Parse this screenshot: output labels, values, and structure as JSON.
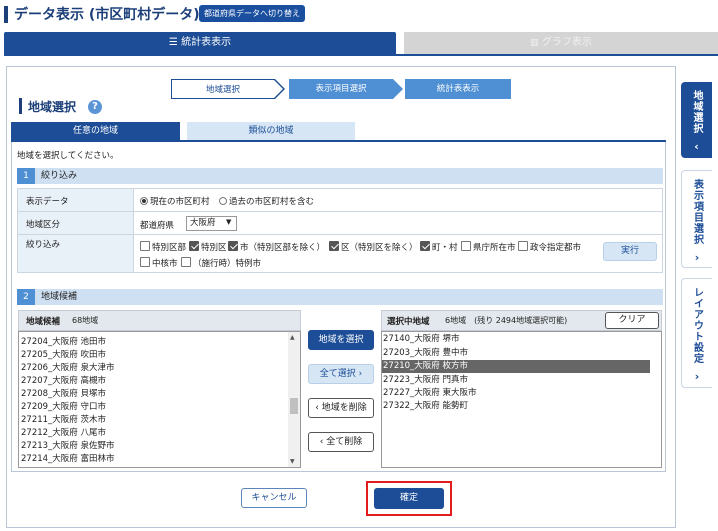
{
  "page": {
    "title": "データ表示 (市区町村データ)",
    "switch_button": "都道府県データへ切り替え"
  },
  "top_tabs": {
    "stats": "統計表表示",
    "graph": "グラフ表示"
  },
  "steps": [
    "地域選択",
    "表示項目選択",
    "統計表表示"
  ],
  "heading": "地域選択",
  "help_icon": "?",
  "sub_tabs": [
    "任意の地域",
    "類似の地域"
  ],
  "instruction": "地域を選択してください。",
  "section1": {
    "num": "1",
    "label": "絞り込み",
    "rows": {
      "display_data": {
        "label": "表示データ",
        "options": [
          "現在の市区町村",
          "過去の市区町村を含む"
        ],
        "selected": 0
      },
      "region_type": {
        "label": "地域区分",
        "prefix": "都道府県",
        "select_value": "大阪府"
      },
      "filter": {
        "label": "絞り込み",
        "checkboxes": [
          {
            "label": "特別区部",
            "checked": false
          },
          {
            "label": "特別区",
            "checked": true
          },
          {
            "label": "市（特別区部を除く）",
            "checked": true
          },
          {
            "label": "区（特別区を除く）",
            "checked": true
          },
          {
            "label": "町・村",
            "checked": true
          },
          {
            "label": "県庁所在市",
            "checked": false
          },
          {
            "label": "政令指定都市",
            "checked": false
          },
          {
            "label": "中核市",
            "checked": false
          },
          {
            "label": "（施行時）特例市",
            "checked": false
          }
        ],
        "run_button": "実行"
      }
    }
  },
  "section2": {
    "num": "2",
    "label": "地域候補"
  },
  "candidates": {
    "title": "地域候補",
    "count": "68地域",
    "items": [
      "27204_大阪府 池田市",
      "27205_大阪府 吹田市",
      "27206_大阪府 泉大津市",
      "27207_大阪府 高槻市",
      "27208_大阪府 貝塚市",
      "27209_大阪府 守口市",
      "27211_大阪府 茨木市",
      "27212_大阪府 八尾市",
      "27213_大阪府 泉佐野市",
      "27214_大阪府 富田林市"
    ]
  },
  "middle_buttons": {
    "select": "地域を選択",
    "select_all": "全て選択",
    "remove": "地域を削除",
    "remove_all": "全て削除"
  },
  "selected": {
    "title": "選択中地域",
    "count": "6地域　(残り 2494地域選択可能)",
    "clear": "クリア",
    "items": [
      "27140_大阪府 堺市",
      "27203_大阪府 豊中市",
      "27210_大阪府 枚方市",
      "27223_大阪府 門真市",
      "27227_大阪府 東大阪市",
      "27322_大阪府 能勢町"
    ],
    "highlighted_index": 2
  },
  "bottom": {
    "cancel": "キャンセル",
    "confirm": "確定"
  },
  "sidebar": {
    "region": "地域選択",
    "items": "表示項目選択",
    "layout": "レイアウト設定"
  },
  "icons": {
    "stats_icon": "list-icon",
    "graph_icon": "bar-chart-icon"
  },
  "colors": {
    "primary": "#1c4d96",
    "step_active": "#4f8fd3",
    "highlight_border": "#e21b1b"
  }
}
